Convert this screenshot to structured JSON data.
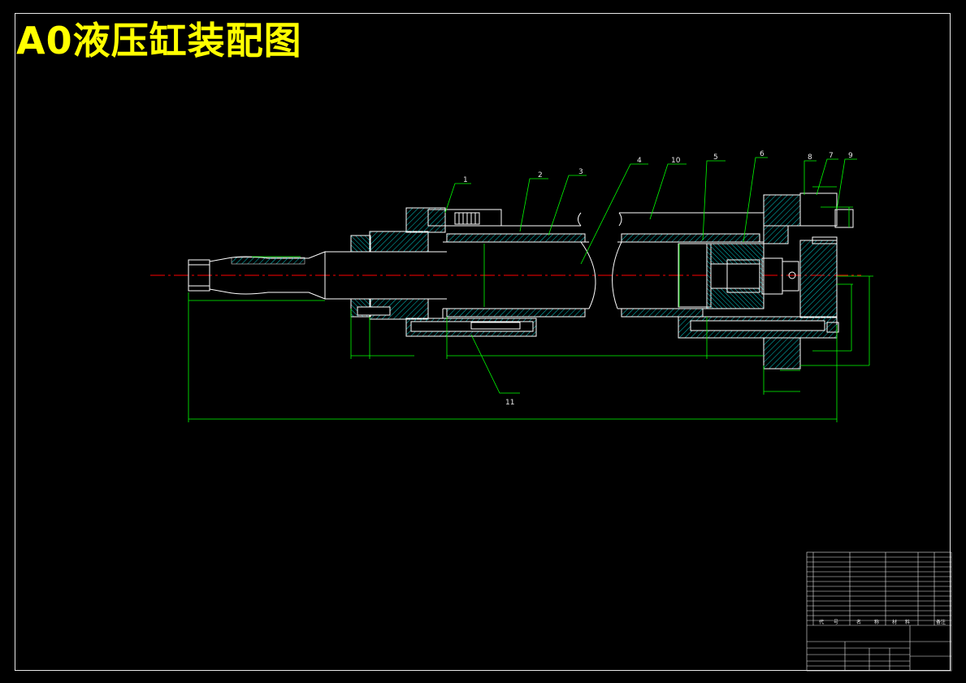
{
  "title": "A0液压缸装配图",
  "colors": {
    "background": "#000000",
    "outline": "#ffffff",
    "hatch": "#00c8c8",
    "dimension": "#00ff00",
    "centerline": "#ff0000",
    "title_text": "#ffff00"
  },
  "balloons": [
    "1",
    "2",
    "3",
    "4",
    "10",
    "5",
    "6",
    "8",
    "7",
    "9",
    "11"
  ],
  "title_block": {
    "header": [
      "代",
      "号",
      "名",
      "称",
      "材",
      "料",
      "备注"
    ]
  }
}
